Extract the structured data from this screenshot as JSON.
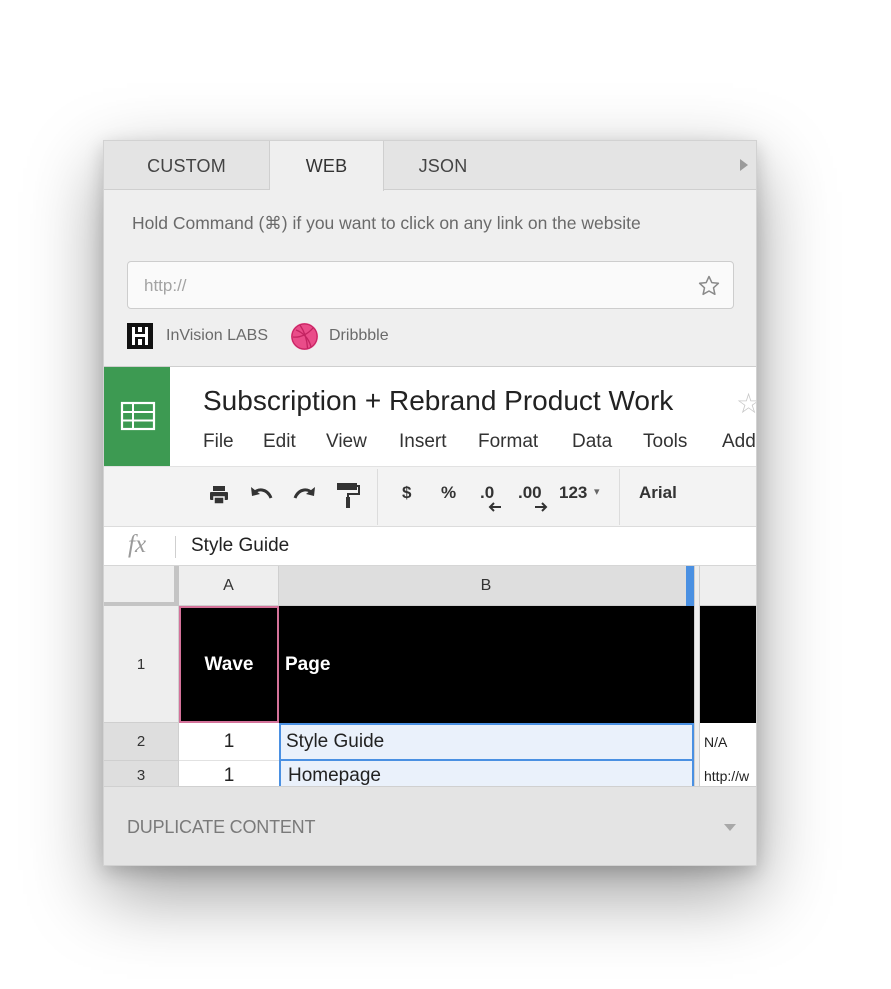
{
  "tabs": [
    {
      "label": "CUSTOM"
    },
    {
      "label": "WEB"
    },
    {
      "label": "JSON"
    }
  ],
  "hint_text": "Hold Command (⌘) if you want to click on any link on the website",
  "url_input": {
    "placeholder": "http://",
    "value": ""
  },
  "quick_links": [
    {
      "label": "InVision LABS",
      "icon": "invision-logo"
    },
    {
      "label": "Dribbble",
      "icon": "dribbble-logo"
    }
  ],
  "preview": {
    "doc_title": "Subscription + Rebrand Product Work",
    "menu": [
      "File",
      "Edit",
      "View",
      "Insert",
      "Format",
      "Data",
      "Tools",
      "Add"
    ],
    "toolbar": {
      "currency": "$",
      "percent": "%",
      "decimal_decrease": ".0",
      "decimal_increase": ".00",
      "number_format": "123",
      "font": "Arial"
    },
    "formula_bar": {
      "fx": "fx",
      "value": "Style Guide"
    },
    "columns": [
      "A",
      "B"
    ],
    "rows": [
      {
        "num": "1",
        "a": "Wave",
        "b": "Page",
        "c": ""
      },
      {
        "num": "2",
        "a": "1",
        "b": "Style Guide",
        "c": "N/A"
      },
      {
        "num": "3",
        "a": "1",
        "b": "Homepage",
        "c": "http://w"
      }
    ]
  },
  "bottom": {
    "label": "DUPLICATE CONTENT"
  },
  "colors": {
    "sheets_green": "#3d9a52",
    "dribbble_pink": "#ea4c89",
    "selection_blue": "#4a90e2",
    "header_row_bg": "#000000",
    "active_cell_border": "#d4729a"
  }
}
